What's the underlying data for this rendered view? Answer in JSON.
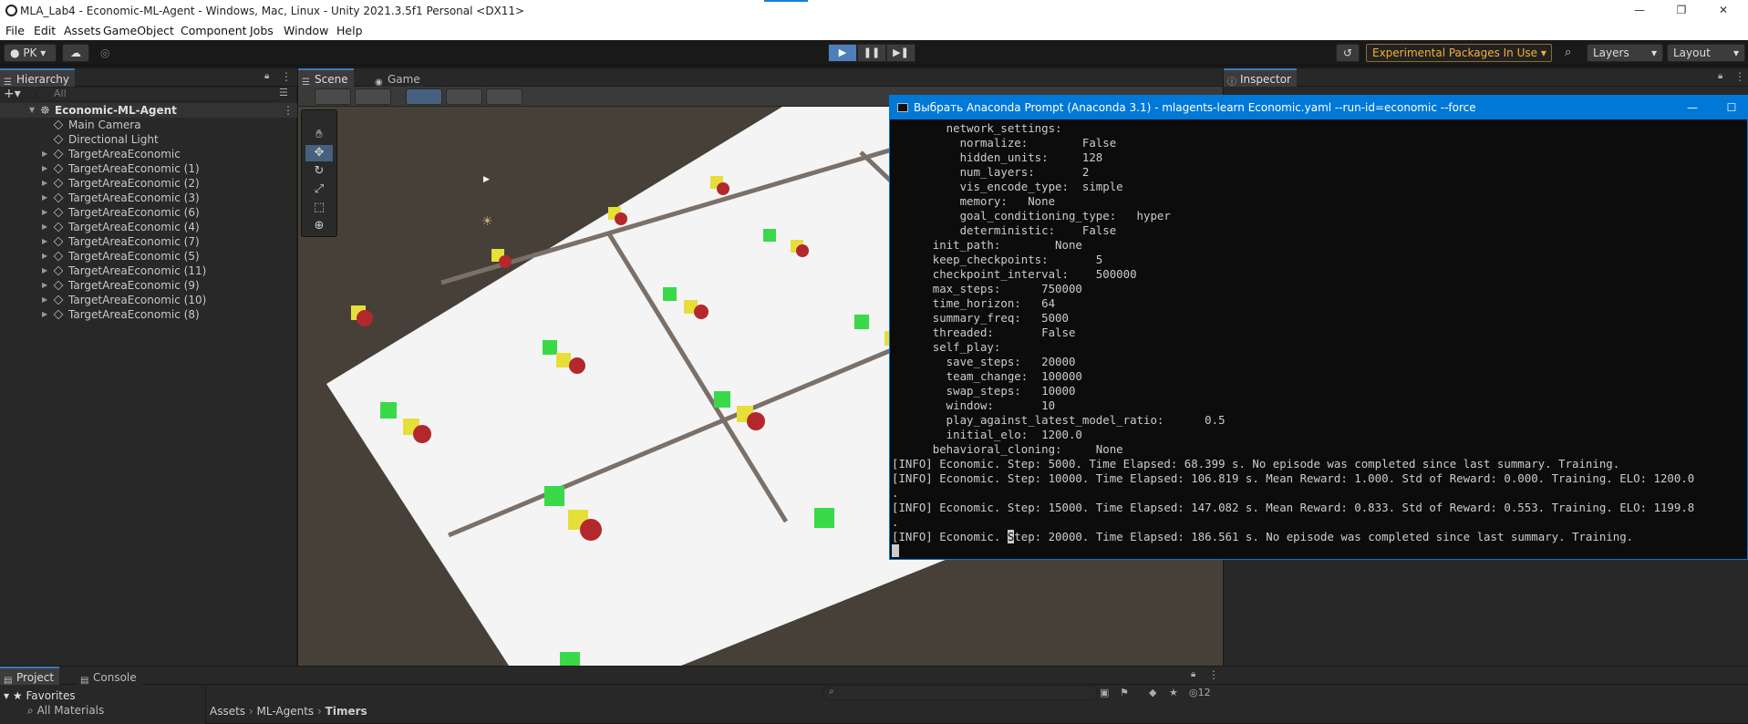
{
  "window": {
    "title": "MLA_Lab4 - Economic-ML-Agent - Windows, Mac, Linux - Unity 2021.3.5f1 Personal <DX11>",
    "min_icon": "minimize-icon",
    "max_icon": "maximize-icon",
    "close_icon": "close-icon"
  },
  "menu": [
    "File",
    "Edit",
    "Assets",
    "GameObject",
    "Component",
    "Jobs",
    "Window",
    "Help"
  ],
  "toolbar": {
    "account": "PK",
    "play_icon": "▶",
    "pause_icon": "❚❚",
    "step_icon": "▶❚",
    "experimental": "Experimental Packages In Use",
    "layers": "Layers",
    "layout": "Layout"
  },
  "hierarchy": {
    "tab": "Hierarchy",
    "search_placeholder": "All",
    "root": "Economic-ML-Agent",
    "children_plain": [
      "Main Camera",
      "Directional Light"
    ],
    "children": [
      "TargetAreaEconomic",
      "TargetAreaEconomic (1)",
      "TargetAreaEconomic (2)",
      "TargetAreaEconomic (3)",
      "TargetAreaEconomic (6)",
      "TargetAreaEconomic (4)",
      "TargetAreaEconomic (7)",
      "TargetAreaEconomic (5)",
      "TargetAreaEconomic (11)",
      "TargetAreaEconomic (9)",
      "TargetAreaEconomic (10)",
      "TargetAreaEconomic (8)"
    ]
  },
  "scene": {
    "tab_scene": "Scene",
    "tab_game": "Game"
  },
  "inspector": {
    "tab": "Inspector"
  },
  "project": {
    "tab_project": "Project",
    "tab_console": "Console",
    "favorites": "Favorites",
    "favorites_item": "All Materials",
    "crumb": [
      "Assets",
      "ML-Agents",
      "Timers"
    ],
    "hidden_count": "12"
  },
  "console": {
    "title": "Выбрать Anaconda Prompt (Anaconda 3.1) - mlagents-learn  Economic.yaml --run-id=economic --force",
    "lines": [
      "        network_settings:",
      "          normalize:        False",
      "          hidden_units:     128",
      "          num_layers:       2",
      "          vis_encode_type:  simple",
      "          memory:   None",
      "          goal_conditioning_type:   hyper",
      "          deterministic:    False",
      "      init_path:        None",
      "      keep_checkpoints:       5",
      "      checkpoint_interval:    500000",
      "      max_steps:      750000",
      "      time_horizon:   64",
      "      summary_freq:   5000",
      "      threaded:       False",
      "      self_play:",
      "        save_steps:   20000",
      "        team_change:  100000",
      "        swap_steps:   10000",
      "        window:       10",
      "        play_against_latest_model_ratio:      0.5",
      "        initial_elo:  1200.0",
      "      behavioral_cloning:     None",
      "[INFO] Economic. Step: 5000. Time Elapsed: 68.399 s. No episode was completed since last summary. Training.",
      "[INFO] Economic. Step: 10000. Time Elapsed: 106.819 s. Mean Reward: 1.000. Std of Reward: 0.000. Training. ELO: 1200.0",
      ".",
      "[INFO] Economic. Step: 15000. Time Elapsed: 147.082 s. Mean Reward: 0.833. Std of Reward: 0.553. Training. ELO: 1199.8",
      "."
    ],
    "last_prefix": "[INFO] Economic. ",
    "last_cursor_char": "S",
    "last_rest": "tep: 20000. Time Elapsed: 186.561 s. No episode was completed since last summary. Training."
  }
}
